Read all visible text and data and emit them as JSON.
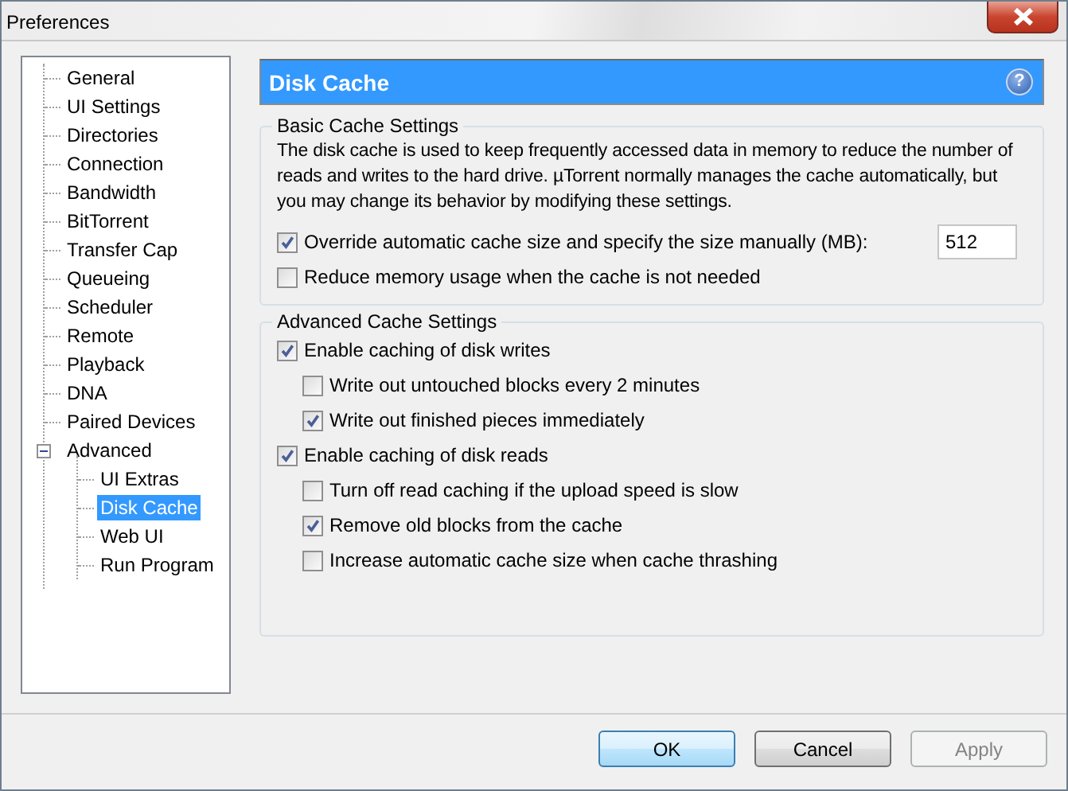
{
  "window": {
    "title": "Preferences"
  },
  "sidebar": {
    "items": [
      {
        "label": "General",
        "selected": false
      },
      {
        "label": "UI Settings",
        "selected": false
      },
      {
        "label": "Directories",
        "selected": false
      },
      {
        "label": "Connection",
        "selected": false
      },
      {
        "label": "Bandwidth",
        "selected": false
      },
      {
        "label": "BitTorrent",
        "selected": false
      },
      {
        "label": "Transfer Cap",
        "selected": false
      },
      {
        "label": "Queueing",
        "selected": false
      },
      {
        "label": "Scheduler",
        "selected": false
      },
      {
        "label": "Remote",
        "selected": false
      },
      {
        "label": "Playback",
        "selected": false
      },
      {
        "label": "DNA",
        "selected": false
      },
      {
        "label": "Paired Devices",
        "selected": false
      },
      {
        "label": "Advanced",
        "selected": false,
        "expanded": true,
        "children": [
          {
            "label": "UI Extras",
            "selected": false
          },
          {
            "label": "Disk Cache",
            "selected": true
          },
          {
            "label": "Web UI",
            "selected": false
          },
          {
            "label": "Run Program",
            "selected": false
          }
        ]
      }
    ]
  },
  "page": {
    "title": "Disk Cache",
    "help": "?"
  },
  "groups": [
    {
      "title": "Basic Cache Settings",
      "items": [
        {
          "kind": "text",
          "text": "The disk cache is used to keep frequently accessed data in memory to reduce the number of reads and writes to the hard drive. µTorrent normally manages the cache automatically, but you may change its behavior by modifying these settings."
        },
        {
          "kind": "checkbox",
          "label": "Override automatic cache size and specify the size manually (MB):",
          "checked": true,
          "value": "512"
        },
        {
          "kind": "checkbox",
          "label": "Reduce memory usage when the cache is not needed",
          "checked": false
        }
      ]
    },
    {
      "title": "Advanced Cache Settings",
      "items": [
        {
          "kind": "checkbox",
          "label": "Enable caching of disk writes",
          "checked": true,
          "children": [
            {
              "kind": "checkbox",
              "label": "Write out untouched blocks every 2 minutes",
              "checked": false
            },
            {
              "kind": "checkbox",
              "label": "Write out finished pieces immediately",
              "checked": true
            }
          ]
        },
        {
          "kind": "checkbox",
          "label": "Enable caching of disk reads",
          "checked": true,
          "children": [
            {
              "kind": "checkbox",
              "label": "Turn off read caching if the upload speed is slow",
              "checked": false
            },
            {
              "kind": "checkbox",
              "label": "Remove old blocks from the cache",
              "checked": true
            },
            {
              "kind": "checkbox",
              "label": "Increase automatic cache size when cache thrashing",
              "checked": false
            }
          ]
        }
      ]
    }
  ],
  "buttons": [
    {
      "label": "OK",
      "kind": "default",
      "disabled": false
    },
    {
      "label": "Cancel",
      "kind": "normal",
      "disabled": false
    },
    {
      "label": "Apply",
      "kind": "normal",
      "disabled": true
    }
  ]
}
